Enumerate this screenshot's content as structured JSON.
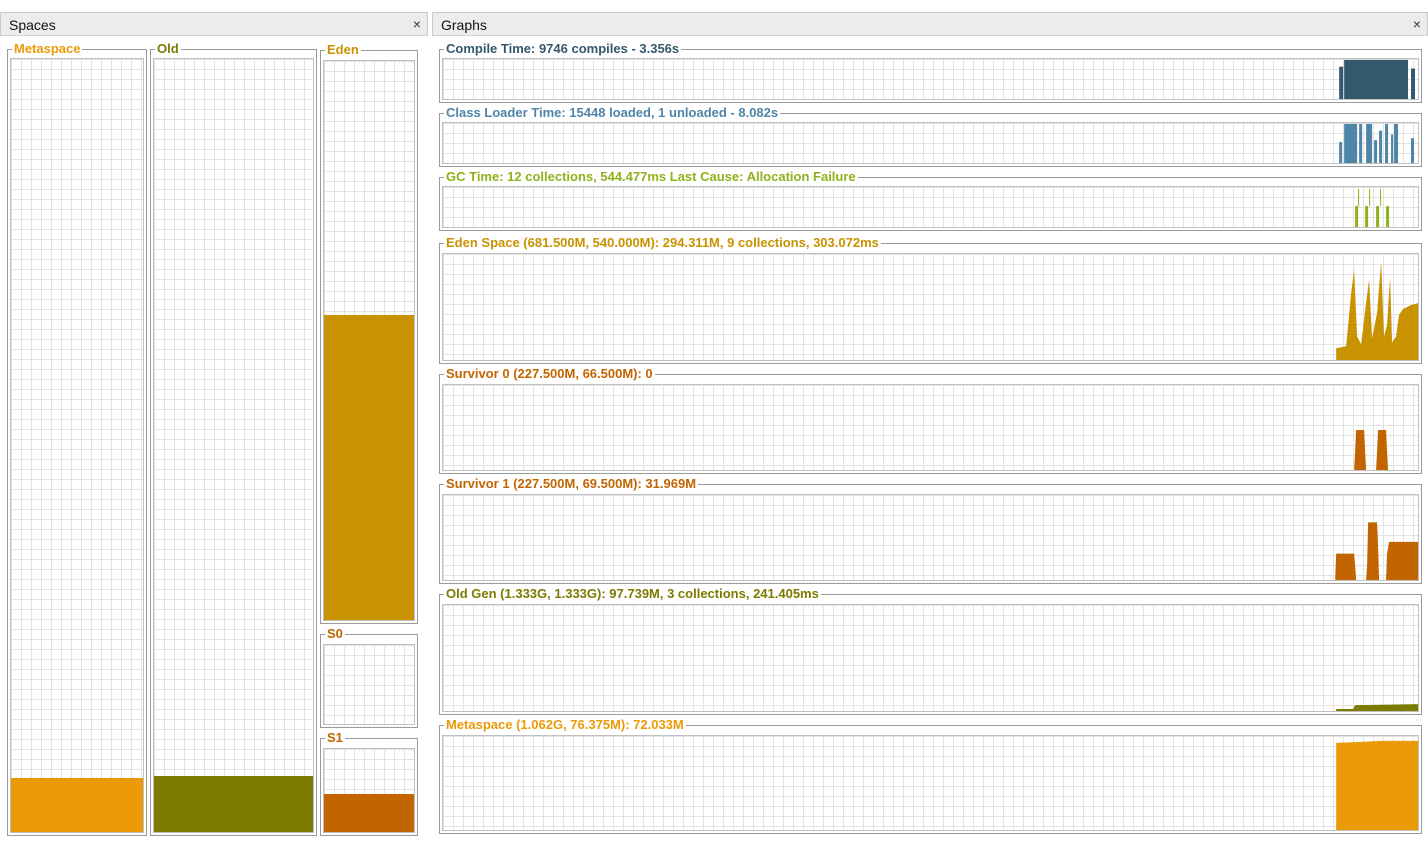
{
  "spaces_panel": {
    "title": "Spaces",
    "close_glyph": "×",
    "metaspace": {
      "label": "Metaspace",
      "color": "#ea9a07",
      "fill_fraction": 0.07
    },
    "old": {
      "label": "Old",
      "color": "#7d7a00",
      "fill_fraction": 0.073
    },
    "eden": {
      "label": "Eden",
      "color": "#c99200",
      "fill_fraction": 0.545
    },
    "s0": {
      "label": "S0",
      "color": "#c26500",
      "fill_fraction": 0.0
    },
    "s1": {
      "label": "S1",
      "color": "#c26500",
      "fill_fraction": 0.46
    }
  },
  "graphs_panel": {
    "title": "Graphs",
    "close_glyph": "×",
    "graphs": [
      {
        "label": "Compile Time: 9746 compiles - 3.356s",
        "color": "#34586c"
      },
      {
        "label": "Class Loader Time: 15448 loaded, 1 unloaded - 8.082s",
        "color": "#4f86a8"
      },
      {
        "label": "GC Time: 12 collections, 544.477ms Last Cause: Allocation Failure",
        "color": "#8eb21b"
      },
      {
        "label": "Eden Space (681.500M, 540.000M): 294.311M, 9 collections, 303.072ms",
        "color": "#c99200"
      },
      {
        "label": "Survivor 0 (227.500M, 66.500M): 0",
        "color": "#c26500"
      },
      {
        "label": "Survivor 1 (227.500M, 69.500M): 31.969M",
        "color": "#c26500"
      },
      {
        "label": "Old Gen (1.333G, 1.333G): 97.739M, 3 collections, 241.405ms",
        "color": "#7d7a00"
      },
      {
        "label": "Metaspace (1.062G, 76.375M): 72.033M",
        "color": "#ea9a07"
      }
    ]
  }
}
